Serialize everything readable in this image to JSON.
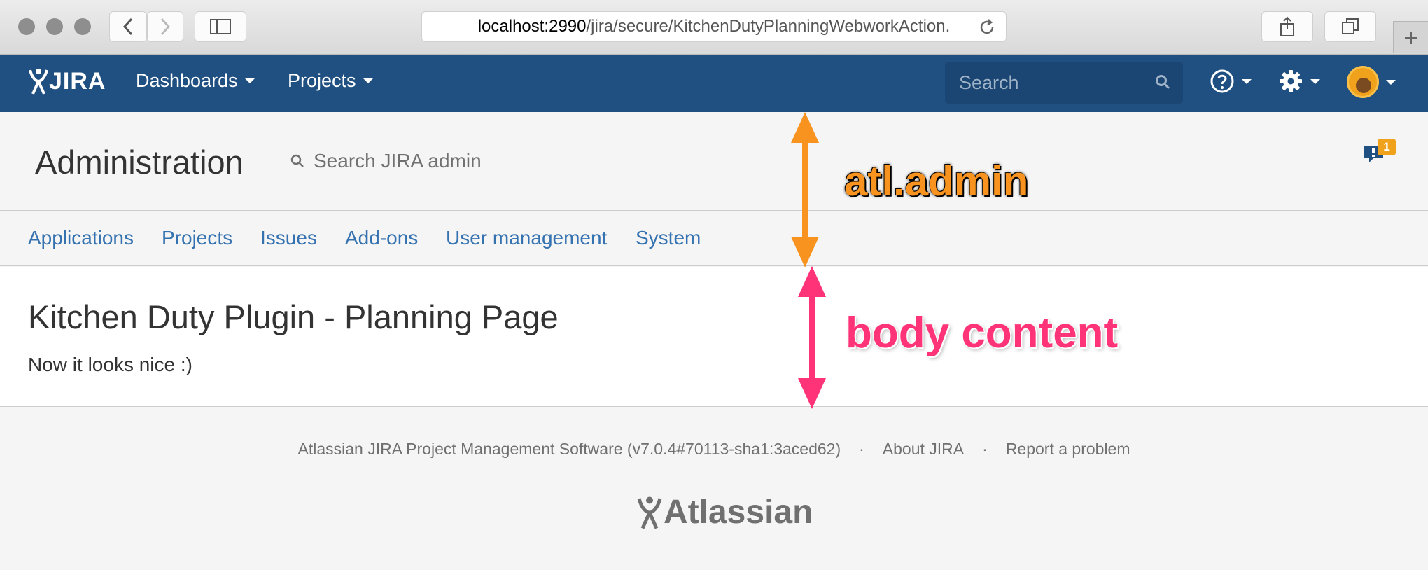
{
  "browser": {
    "url_host": "localhost:2990",
    "url_path": "/jira/secure/KitchenDutyPlanningWebworkAction."
  },
  "header": {
    "logo_text": "JIRA",
    "nav": [
      "Dashboards",
      "Projects"
    ],
    "search_placeholder": "Search",
    "brand_color": "#205081"
  },
  "admin": {
    "title": "Administration",
    "search_label": "Search JIRA admin",
    "notification_count": "1",
    "tabs": [
      "Applications",
      "Projects",
      "Issues",
      "Add-ons",
      "User management",
      "System"
    ]
  },
  "body": {
    "heading": "Kitchen Duty Plugin - Planning Page",
    "text": "Now it looks nice :)"
  },
  "footer": {
    "software": "Atlassian JIRA Project Management Software (v7.0.4#70113-sha1:3aced62)",
    "sep": "·",
    "about": "About JIRA",
    "report": "Report a problem",
    "logo_text": "Atlassian"
  },
  "annotations": {
    "admin_label": "atl.admin",
    "body_label": "body content",
    "admin_color": "#f7931e",
    "body_color": "#ff3377"
  }
}
